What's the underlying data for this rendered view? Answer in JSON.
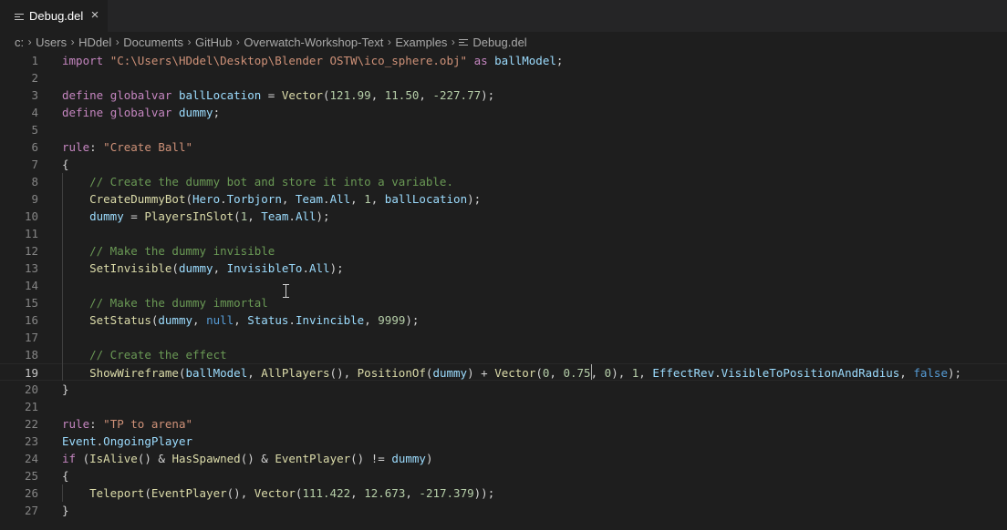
{
  "tab": {
    "label": "Debug.del",
    "file_icon": "file-lines-icon",
    "close_icon": "close-icon",
    "close_symbol": "×"
  },
  "breadcrumb": {
    "items": [
      "c:",
      "Users",
      "HDdel",
      "Documents",
      "GitHub",
      "Overwatch-Workshop-Text",
      "Examples"
    ],
    "file": "Debug.del",
    "separator": "›"
  },
  "colors": {
    "background": "#1e1e1e",
    "keyword": "#c586c0",
    "string": "#ce9178",
    "function": "#dcdcaa",
    "variable": "#9cdcfe",
    "number": "#b5cea8",
    "comment": "#6a9955",
    "type": "#4ec9b0"
  },
  "editor": {
    "current_line": 19,
    "lines": [
      [
        [
          "kw",
          "import"
        ],
        [
          "txt",
          " "
        ],
        [
          "str",
          "\"C:\\Users\\HDdel\\Desktop\\Blender OSTW\\ico_sphere.obj\""
        ],
        [
          "txt",
          " "
        ],
        [
          "kw",
          "as"
        ],
        [
          "txt",
          " "
        ],
        [
          "var",
          "ballModel"
        ],
        [
          "txt",
          ";"
        ]
      ],
      [],
      [
        [
          "kw",
          "define"
        ],
        [
          "txt",
          " "
        ],
        [
          "kw",
          "globalvar"
        ],
        [
          "txt",
          " "
        ],
        [
          "var",
          "ballLocation"
        ],
        [
          "txt",
          " = "
        ],
        [
          "fn",
          "Vector"
        ],
        [
          "txt",
          "("
        ],
        [
          "num",
          "121.99"
        ],
        [
          "txt",
          ", "
        ],
        [
          "num",
          "11.50"
        ],
        [
          "txt",
          ", "
        ],
        [
          "num",
          "-227.77"
        ],
        [
          "txt",
          ");"
        ]
      ],
      [
        [
          "kw",
          "define"
        ],
        [
          "txt",
          " "
        ],
        [
          "kw",
          "globalvar"
        ],
        [
          "txt",
          " "
        ],
        [
          "var",
          "dummy"
        ],
        [
          "txt",
          ";"
        ]
      ],
      [],
      [
        [
          "kw",
          "rule"
        ],
        [
          "txt",
          ": "
        ],
        [
          "str",
          "\"Create Ball\""
        ]
      ],
      [
        [
          "txt",
          "{"
        ]
      ],
      [
        [
          "txt",
          "    "
        ],
        [
          "cm",
          "// Create the dummy bot and store it into a variable."
        ]
      ],
      [
        [
          "txt",
          "    "
        ],
        [
          "fn",
          "CreateDummyBot"
        ],
        [
          "txt",
          "("
        ],
        [
          "var",
          "Hero"
        ],
        [
          "txt",
          "."
        ],
        [
          "var",
          "Torbjorn"
        ],
        [
          "txt",
          ", "
        ],
        [
          "var",
          "Team"
        ],
        [
          "txt",
          "."
        ],
        [
          "var",
          "All"
        ],
        [
          "txt",
          ", "
        ],
        [
          "num",
          "1"
        ],
        [
          "txt",
          ", "
        ],
        [
          "var",
          "ballLocation"
        ],
        [
          "txt",
          ");"
        ]
      ],
      [
        [
          "txt",
          "    "
        ],
        [
          "var",
          "dummy"
        ],
        [
          "txt",
          " = "
        ],
        [
          "fn",
          "PlayersInSlot"
        ],
        [
          "txt",
          "("
        ],
        [
          "num",
          "1"
        ],
        [
          "txt",
          ", "
        ],
        [
          "var",
          "Team"
        ],
        [
          "txt",
          "."
        ],
        [
          "var",
          "All"
        ],
        [
          "txt",
          ");"
        ]
      ],
      [],
      [
        [
          "txt",
          "    "
        ],
        [
          "cm",
          "// Make the dummy invisible"
        ]
      ],
      [
        [
          "txt",
          "    "
        ],
        [
          "fn",
          "SetInvisible"
        ],
        [
          "txt",
          "("
        ],
        [
          "var",
          "dummy"
        ],
        [
          "txt",
          ", "
        ],
        [
          "var",
          "InvisibleTo"
        ],
        [
          "txt",
          "."
        ],
        [
          "var",
          "All"
        ],
        [
          "txt",
          ");"
        ]
      ],
      [],
      [
        [
          "txt",
          "    "
        ],
        [
          "cm",
          "// Make the dummy immortal"
        ]
      ],
      [
        [
          "txt",
          "    "
        ],
        [
          "fn",
          "SetStatus"
        ],
        [
          "txt",
          "("
        ],
        [
          "var",
          "dummy"
        ],
        [
          "txt",
          ", "
        ],
        [
          "kwb",
          "null"
        ],
        [
          "txt",
          ", "
        ],
        [
          "var",
          "Status"
        ],
        [
          "txt",
          "."
        ],
        [
          "var",
          "Invincible"
        ],
        [
          "txt",
          ", "
        ],
        [
          "num",
          "9999"
        ],
        [
          "txt",
          ");"
        ]
      ],
      [],
      [
        [
          "txt",
          "    "
        ],
        [
          "cm",
          "// Create the effect"
        ]
      ],
      [
        [
          "txt",
          "    "
        ],
        [
          "fn",
          "ShowWireframe"
        ],
        [
          "txt",
          "("
        ],
        [
          "var",
          "ballModel"
        ],
        [
          "txt",
          ", "
        ],
        [
          "fn",
          "AllPlayers"
        ],
        [
          "txt",
          "(), "
        ],
        [
          "fn",
          "PositionOf"
        ],
        [
          "txt",
          "("
        ],
        [
          "var",
          "dummy"
        ],
        [
          "txt",
          ") + "
        ],
        [
          "fn",
          "Vector"
        ],
        [
          "txt",
          "("
        ],
        [
          "num",
          "0"
        ],
        [
          "txt",
          ", "
        ],
        [
          "num",
          "0.75"
        ],
        [
          "txt",
          ", "
        ],
        [
          "num",
          "0"
        ],
        [
          "txt",
          "), "
        ],
        [
          "num",
          "1"
        ],
        [
          "txt",
          ", "
        ],
        [
          "var",
          "EffectRev"
        ],
        [
          "txt",
          "."
        ],
        [
          "var",
          "VisibleToPositionAndRadius"
        ],
        [
          "txt",
          ", "
        ],
        [
          "kwb",
          "false"
        ],
        [
          "txt",
          ");"
        ]
      ],
      [
        [
          "txt",
          "}"
        ]
      ],
      [],
      [
        [
          "kw",
          "rule"
        ],
        [
          "txt",
          ": "
        ],
        [
          "str",
          "\"TP to arena\""
        ]
      ],
      [
        [
          "var",
          "Event"
        ],
        [
          "txt",
          "."
        ],
        [
          "var",
          "OngoingPlayer"
        ]
      ],
      [
        [
          "kw",
          "if"
        ],
        [
          "txt",
          " ("
        ],
        [
          "fn",
          "IsAlive"
        ],
        [
          "txt",
          "() & "
        ],
        [
          "fn",
          "HasSpawned"
        ],
        [
          "txt",
          "() & "
        ],
        [
          "fn",
          "EventPlayer"
        ],
        [
          "txt",
          "() != "
        ],
        [
          "var",
          "dummy"
        ],
        [
          "txt",
          ")"
        ]
      ],
      [
        [
          "txt",
          "{"
        ]
      ],
      [
        [
          "txt",
          "    "
        ],
        [
          "fn",
          "Teleport"
        ],
        [
          "txt",
          "("
        ],
        [
          "fn",
          "EventPlayer"
        ],
        [
          "txt",
          "(), "
        ],
        [
          "fn",
          "Vector"
        ],
        [
          "txt",
          "("
        ],
        [
          "num",
          "111.422"
        ],
        [
          "txt",
          ", "
        ],
        [
          "num",
          "12.673"
        ],
        [
          "txt",
          ", "
        ],
        [
          "num",
          "-217.379"
        ],
        [
          "txt",
          "));"
        ]
      ],
      [
        [
          "txt",
          "}"
        ]
      ]
    ]
  }
}
